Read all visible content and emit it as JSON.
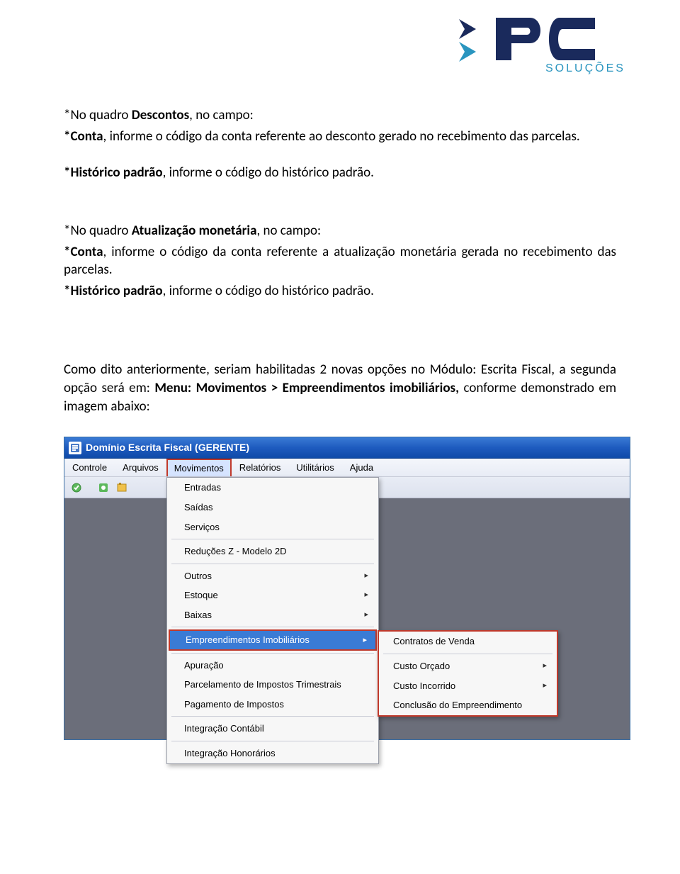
{
  "logo": {
    "brand": "PC",
    "tagline": "SOLUÇÕES"
  },
  "doc": {
    "p1_a": "*No quadro ",
    "p1_b": "Descontos",
    "p1_c": ", no campo:",
    "p2_a": "*Conta",
    "p2_b": ", informe o código da conta referente ao desconto gerado no recebimento das parcelas.",
    "p3_a": "*Histórico padrão",
    "p3_b": ", informe o código do histórico padrão.",
    "p4_a": "*No quadro ",
    "p4_b": "Atualização monetária",
    "p4_c": ", no campo:",
    "p5_a": "*Conta",
    "p5_b": ", informe o código da conta referente a atualização monetária gerada no recebimento das parcelas.",
    "p6_a": "*Histórico padrão",
    "p6_b": ", informe o código do histórico padrão.",
    "p7_a": "Como dito anteriormente, seriam habilitadas 2 novas opções no Módulo: Escrita Fiscal, a segunda opção será em: ",
    "p7_b": "Menu: Movimentos > Empreendimentos imobiliários, ",
    "p7_c": "conforme demonstrado em imagem abaixo:"
  },
  "app": {
    "title": "Domínio Escrita Fiscal (GERENTE)",
    "menubar": [
      "Controle",
      "Arquivos",
      "Movimentos",
      "Relatórios",
      "Utilitários",
      "Ajuda"
    ],
    "selected_menu_index": 2,
    "dropdown": {
      "groups": [
        {
          "items": [
            {
              "label": "Entradas"
            },
            {
              "label": "Saídas"
            },
            {
              "label": "Serviços"
            }
          ]
        },
        {
          "items": [
            {
              "label": "Reduções Z - Modelo 2D"
            }
          ]
        },
        {
          "items": [
            {
              "label": "Outros",
              "has_sub": true
            },
            {
              "label": "Estoque",
              "has_sub": true
            },
            {
              "label": "Baixas",
              "has_sub": true
            }
          ]
        },
        {
          "items": [
            {
              "label": "Empreendimentos Imobiliários",
              "has_sub": true,
              "highlighted": true,
              "redbox": true
            }
          ]
        },
        {
          "items": [
            {
              "label": "Apuração"
            },
            {
              "label": "Parcelamento de Impostos Trimestrais"
            },
            {
              "label": "Pagamento de Impostos"
            }
          ]
        },
        {
          "items": [
            {
              "label": "Integração Contábil"
            }
          ]
        },
        {
          "items": [
            {
              "label": "Integração Honorários"
            }
          ]
        }
      ]
    },
    "submenu": [
      {
        "label": "Contratos de Venda"
      },
      {
        "sep": true
      },
      {
        "label": "Custo Orçado",
        "has_sub": true
      },
      {
        "label": "Custo Incorrido",
        "has_sub": true
      },
      {
        "label": "Conclusão do Empreendimento"
      }
    ]
  }
}
